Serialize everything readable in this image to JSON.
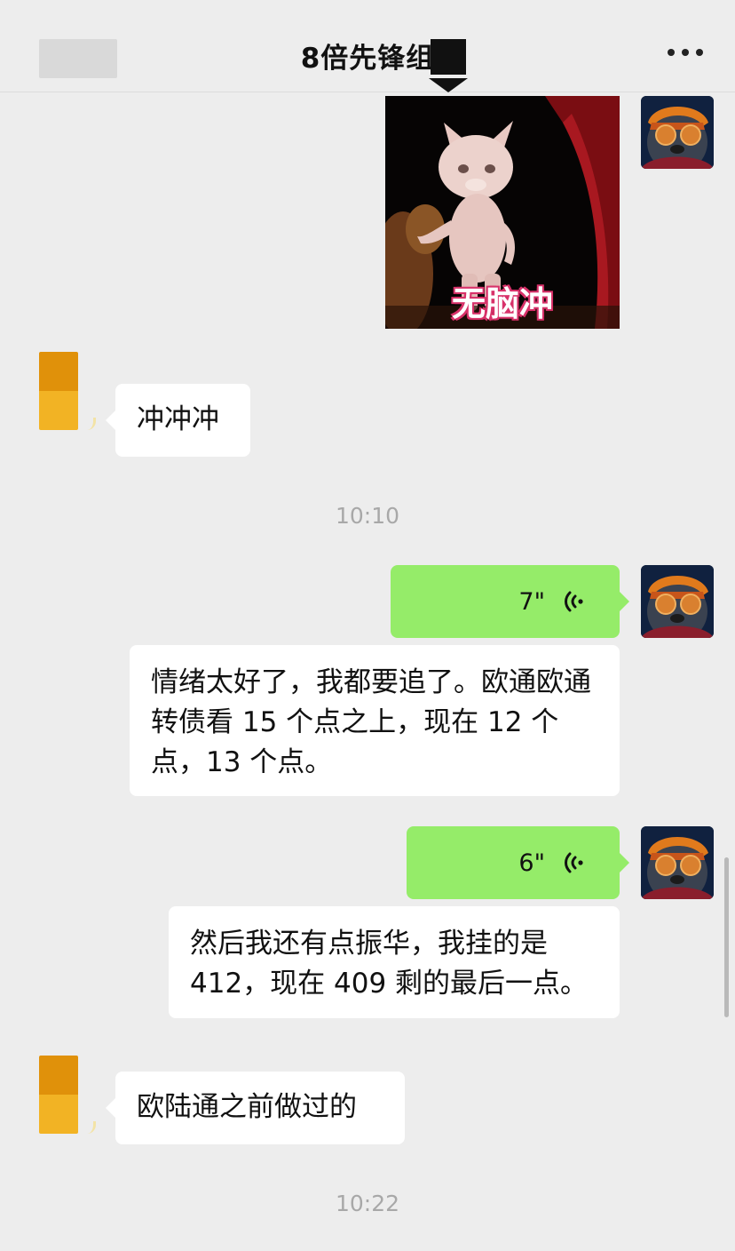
{
  "header": {
    "title": "8倍先锋组",
    "back_icon": "blurred-back",
    "more_icon": "ellipsis-icon"
  },
  "colors": {
    "background": "#ededed",
    "voice_bubble": "#95ec69",
    "text_bubble": "#ffffff",
    "timestamp": "#a8a8a8"
  },
  "messages": {
    "sticker_caption": "无脑冲",
    "msg1": "冲冲冲",
    "time1": "10:10",
    "voice1_duration": "7\"",
    "transcript1": "情绪太好了，我都要追了。欧通欧通转债看 15 个点之上，现在 12 个点，13 个点。",
    "voice2_duration": "6\"",
    "transcript2": "然后我还有点振华，我挂的是 412，现在 409 剩的最后一点。",
    "msg2": "欧陆通之前做过的",
    "time2": "10:22"
  }
}
